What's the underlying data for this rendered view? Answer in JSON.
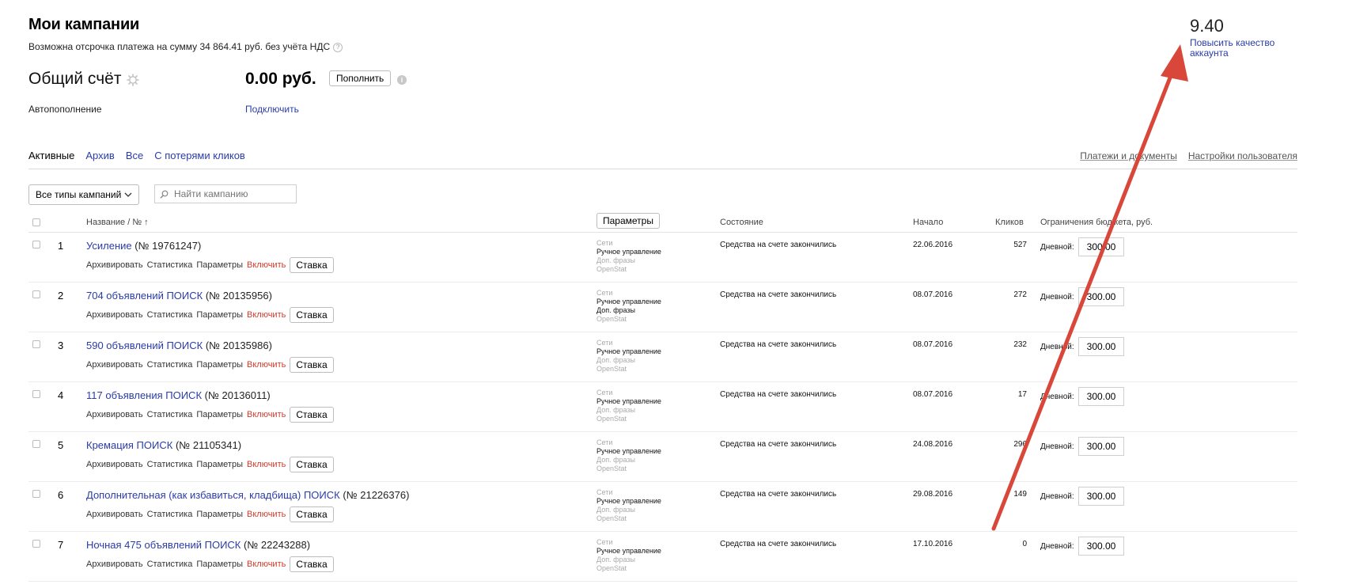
{
  "header": {
    "title": "Мои кампании",
    "deferral_text": "Возможна отсрочка платежа на сумму 34 864.41 руб. без учёта НДС",
    "score": "9.40",
    "improve_link": "Повысить качество аккаунта"
  },
  "account": {
    "title": "Общий счёт",
    "amount": "0.00 руб.",
    "topup_label": "Пополнить",
    "autofill_label": "Автопополнение",
    "autofill_link": "Подключить"
  },
  "tabs": [
    {
      "label": "Активные",
      "active": true
    },
    {
      "label": "Архив",
      "active": false
    },
    {
      "label": "Все",
      "active": false
    },
    {
      "label": "С потерями кликов",
      "active": false
    }
  ],
  "right_links": [
    "Платежи и документы",
    "Настройки пользователя"
  ],
  "filters": {
    "type_select": "Все типы кампаний",
    "search_placeholder": "Найти кампанию"
  },
  "table_headers": {
    "name": "Название / № ↑",
    "params_button": "Параметры",
    "state": "Состояние",
    "start": "Начало",
    "clicks": "Кликов",
    "budget": "Ограничения бюджета, руб."
  },
  "row_labels": {
    "archive": "Архивировать",
    "stats": "Статистика",
    "params": "Параметры",
    "enable": "Включить",
    "bid": "Ставка",
    "daily": "Дневной:",
    "param_lines": [
      "Сети",
      "Ручное управление",
      "Доп. фразы",
      "OpenStat"
    ]
  },
  "campaigns": [
    {
      "num": "1",
      "name": "Усиление",
      "id": "(№ 19761247)",
      "state": "Средства на счете закончились",
      "start": "22.06.2016",
      "clicks": "527",
      "budget": "300.00",
      "extra_phrases_active": false
    },
    {
      "num": "2",
      "name": "704 объявлений ПОИСК",
      "id": "(№ 20135956)",
      "state": "Средства на счете закончились",
      "start": "08.07.2016",
      "clicks": "272",
      "budget": "300.00",
      "extra_phrases_active": true
    },
    {
      "num": "3",
      "name": "590 объявлений ПОИСК",
      "id": "(№ 20135986)",
      "state": "Средства на счете закончились",
      "start": "08.07.2016",
      "clicks": "232",
      "budget": "300.00",
      "extra_phrases_active": false
    },
    {
      "num": "4",
      "name": "117 объявления ПОИСК",
      "id": "(№ 20136011)",
      "state": "Средства на счете закончились",
      "start": "08.07.2016",
      "clicks": "17",
      "budget": "300.00",
      "extra_phrases_active": false
    },
    {
      "num": "5",
      "name": "Кремация ПОИСК",
      "id": "(№ 21105341)",
      "state": "Средства на счете закончились",
      "start": "24.08.2016",
      "clicks": "296",
      "budget": "300.00",
      "extra_phrases_active": false
    },
    {
      "num": "6",
      "name": "Дополнительная (как избавиться, кладбища) ПОИСК",
      "id": "(№ 21226376)",
      "state": "Средства на счете закончились",
      "start": "29.08.2016",
      "clicks": "149",
      "budget": "300.00",
      "extra_phrases_active": false
    },
    {
      "num": "7",
      "name": "Ночная 475 объявлений ПОИСК",
      "id": "(№ 22243288)",
      "state": "Средства на счете закончились",
      "start": "17.10.2016",
      "clicks": "0",
      "budget": "300.00",
      "extra_phrases_active": false
    }
  ],
  "colors": {
    "link": "#2a3ca8",
    "enable": "#d23a2a",
    "annotation_arrow": "#d9473a"
  }
}
